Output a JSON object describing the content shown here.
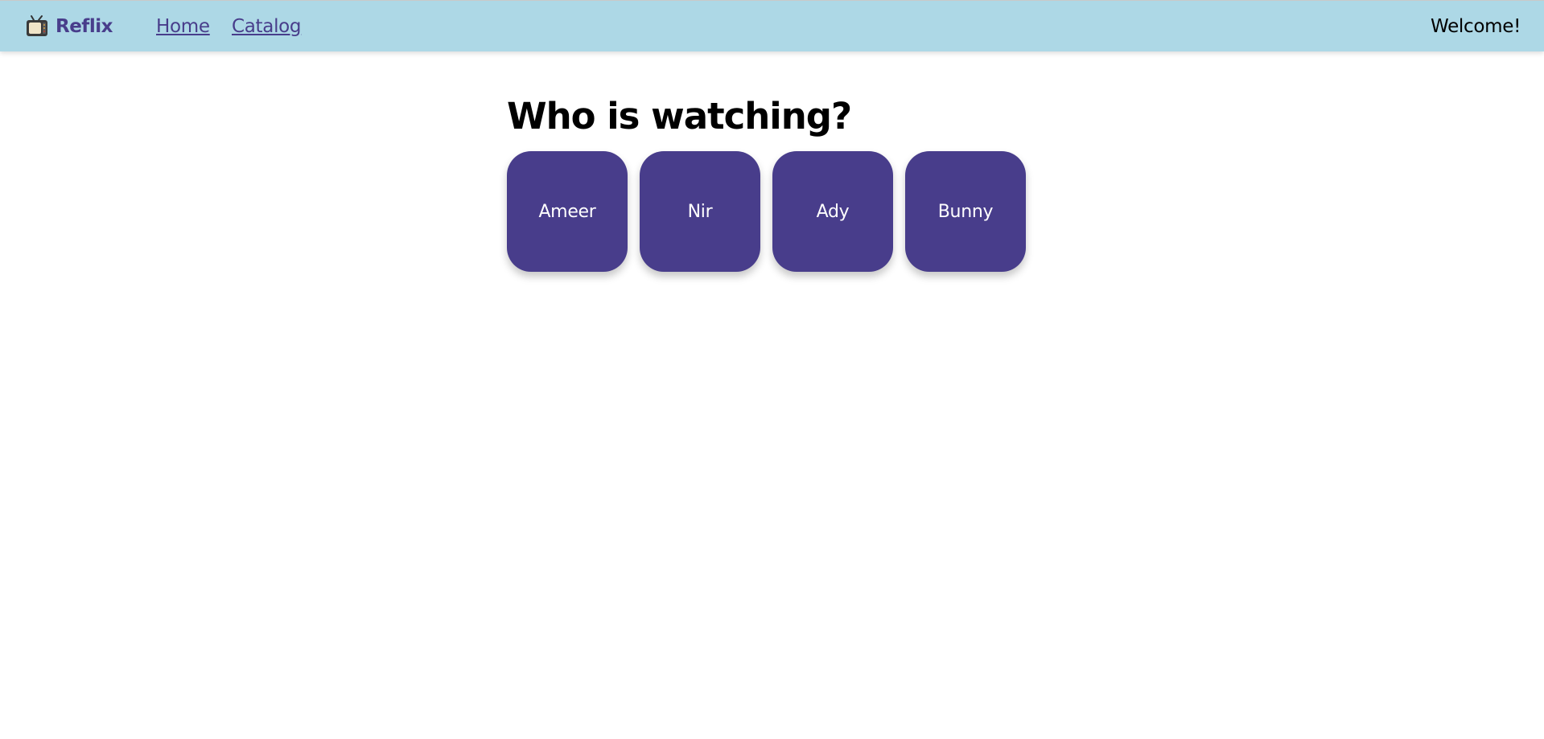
{
  "colors": {
    "navbar_background": "#add8e6",
    "brand_color": "#483d8b",
    "card_background": "#483d8b",
    "card_text": "#ffffff"
  },
  "navbar": {
    "brand": {
      "icon": "tv-icon",
      "name": "Reflix"
    },
    "links": [
      {
        "label": "Home"
      },
      {
        "label": "Catalog"
      }
    ],
    "welcome_text": "Welcome!"
  },
  "main": {
    "title": "Who is watching?",
    "profiles": [
      {
        "name": "Ameer"
      },
      {
        "name": "Nir"
      },
      {
        "name": "Ady"
      },
      {
        "name": "Bunny"
      }
    ]
  }
}
